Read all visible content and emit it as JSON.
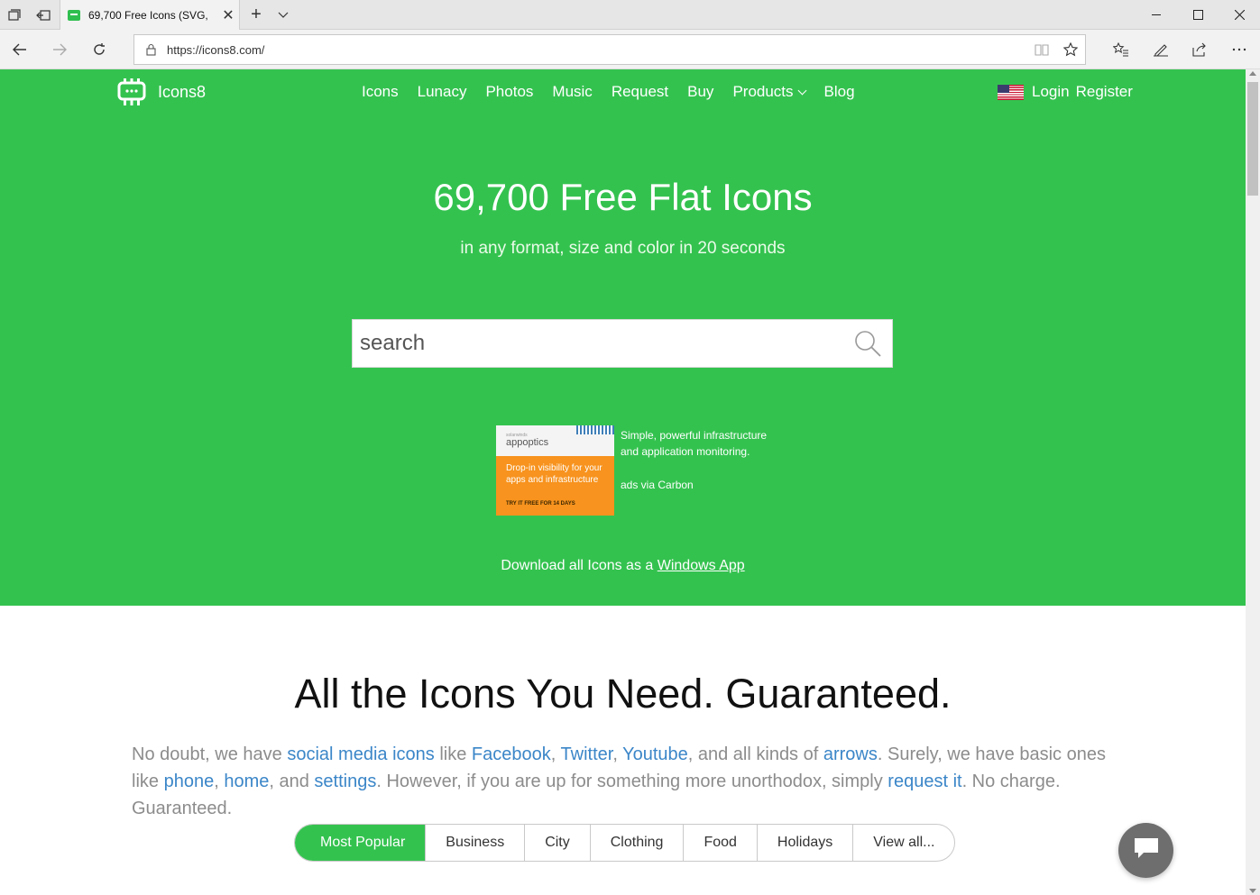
{
  "browser": {
    "tab_title": "69,700 Free Icons (SVG,",
    "url": "https://icons8.com/"
  },
  "site": {
    "logo_text": "Icons8",
    "nav": [
      "Icons",
      "Lunacy",
      "Photos",
      "Music",
      "Request",
      "Buy",
      "Products",
      "Blog"
    ],
    "login": "Login",
    "register": "Register"
  },
  "hero": {
    "title": "69,700 Free Flat Icons",
    "subtitle": "in any format, size and color in 20 seconds",
    "search_placeholder": "search"
  },
  "ad": {
    "brand_small": "solarwinds",
    "brand": "appoptics",
    "copy": "Drop-in visibility for your apps and infrastructure",
    "cta": "TRY IT FREE FOR 14 DAYS",
    "text": "Simple, powerful infrastructure and application monitoring.",
    "via": "ads via Carbon"
  },
  "download": {
    "prefix": "Download all Icons as a",
    "link": "Windows App"
  },
  "section": {
    "title": "All the Icons You Need. Guaranteed.",
    "p1": "No doubt, we have",
    "l_social": "social media icons",
    "p2": "like",
    "l_facebook": "Facebook",
    "c1": ",",
    "l_twitter": "Twitter",
    "c2": ",",
    "l_youtube": "Youtube",
    "p3": ", and all kinds of",
    "l_arrows": "arrows",
    "p4": ". Surely, we have basic ones like",
    "l_phone": "phone",
    "c3": ",",
    "l_home": "home",
    "p5": ", and",
    "l_settings": "settings",
    "p6": ". However, if you are up for something more unorthodox, simply",
    "l_request": "request it",
    "p7": ". No charge. Guaranteed."
  },
  "categories": [
    "Most Popular",
    "Business",
    "City",
    "Clothing",
    "Food",
    "Holidays",
    "View all..."
  ],
  "colors": {
    "brand_green": "#34c24f",
    "link_blue": "#3b86c8"
  }
}
